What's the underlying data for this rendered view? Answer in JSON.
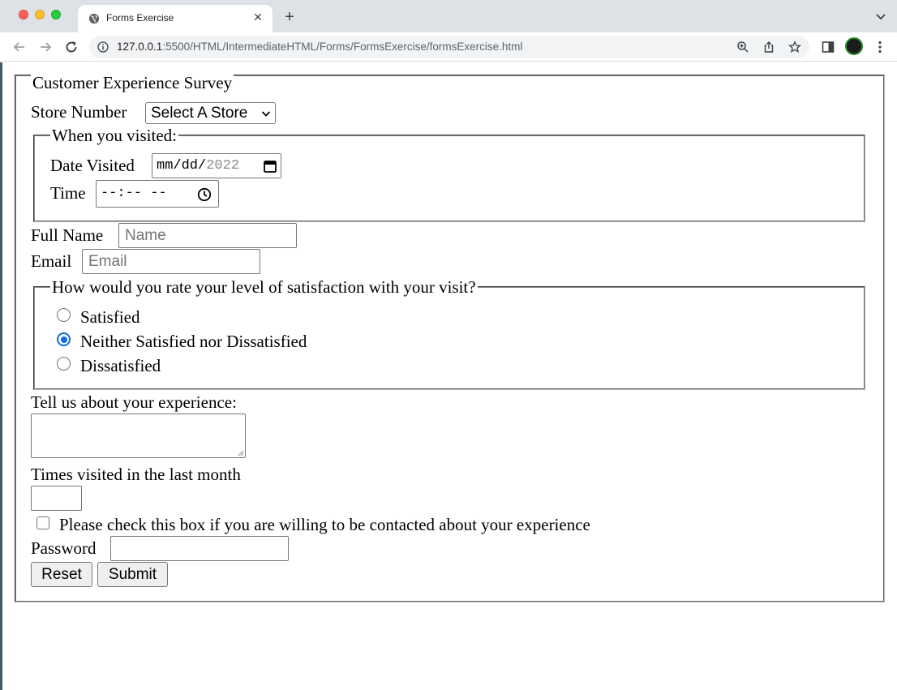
{
  "browser": {
    "tab_title": "Forms Exercise",
    "url_host": "127.0.0.1",
    "url_rest": ":5500/HTML/IntermediateHTML/Forms/FormsExercise/formsExercise.html"
  },
  "form": {
    "legend": "Customer Experience Survey",
    "store": {
      "label": "Store Number",
      "selected": "Select A Store"
    },
    "visit": {
      "legend": "When you visited:",
      "date_label": "Date Visited",
      "date_mm": "mm",
      "date_dd": "dd",
      "date_yyyy": "2022",
      "time_label": "Time",
      "time_value": "--:-- --"
    },
    "full_name": {
      "label": "Full Name",
      "placeholder": "Name"
    },
    "email": {
      "label": "Email",
      "placeholder": "Email"
    },
    "satisfaction": {
      "legend": "How would you rate your level of satisfaction with your visit?",
      "options": [
        {
          "label": "Satisfied",
          "checked": false
        },
        {
          "label": "Neither Satisfied nor Dissatisfied",
          "checked": true
        },
        {
          "label": "Dissatisfied",
          "checked": false
        }
      ]
    },
    "experience_label": "Tell us about your experience:",
    "times_label": "Times visited in the last month",
    "contact_label": "Please check this box if you are willing to be contacted about your experience",
    "password_label": "Password",
    "reset_label": "Reset",
    "submit_label": "Submit"
  },
  "colors": {
    "radio_accent": "#0b6ee0",
    "tabbar_bg": "#dee1e6",
    "omnibox_bg": "#f1f3f4"
  }
}
